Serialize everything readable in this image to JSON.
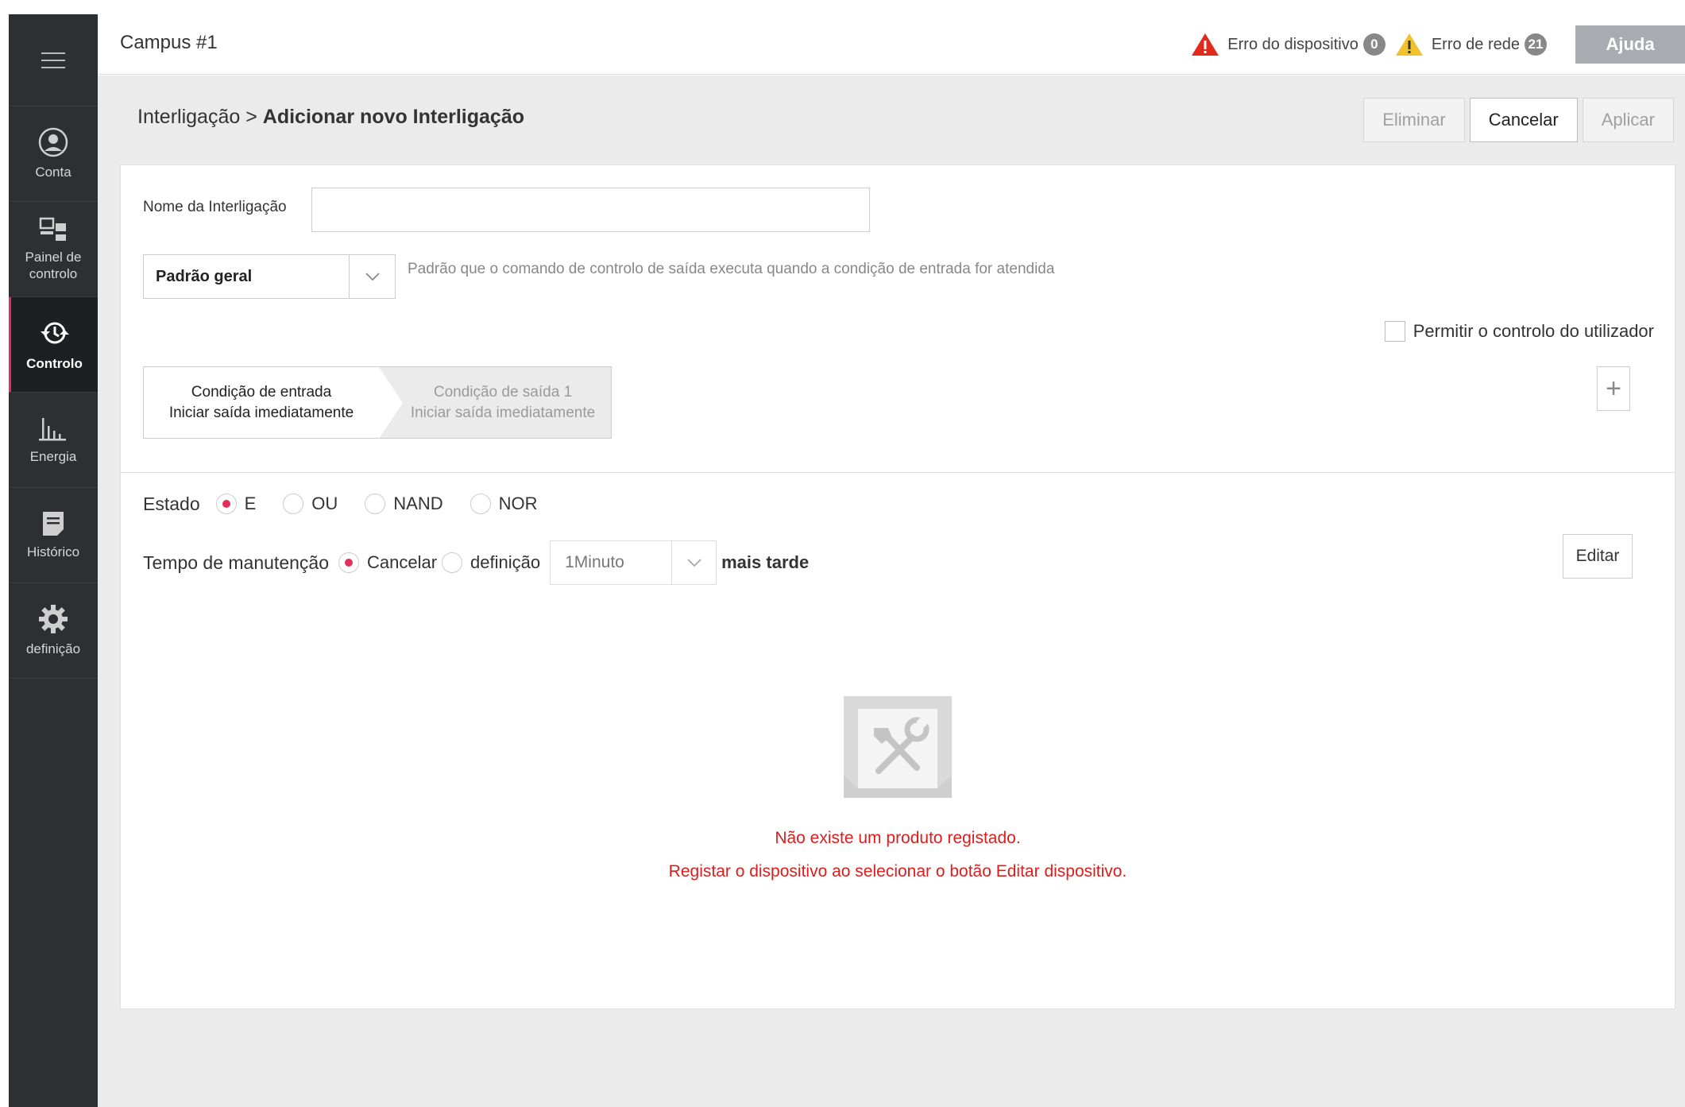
{
  "header": {
    "campus": "Campus #1",
    "device_error_label": "Erro do dispositivo",
    "device_error_count": "0",
    "network_error_label": "Erro de rede",
    "network_error_count": "21",
    "help_label": "Ajuda"
  },
  "sidebar": {
    "items": [
      {
        "label": "Conta",
        "icon": "user-circle-icon"
      },
      {
        "label": "Painel de controlo",
        "icon": "dashboard-icon"
      },
      {
        "label": "Controlo",
        "icon": "control-icon",
        "active": true
      },
      {
        "label": "Energia",
        "icon": "bar-chart-icon"
      },
      {
        "label": "Histórico",
        "icon": "document-icon"
      },
      {
        "label": "definição",
        "icon": "gear-icon"
      }
    ]
  },
  "breadcrumb": {
    "parent": "Interligação",
    "separator": ">",
    "current": "Adicionar novo Interligação"
  },
  "actions": {
    "delete": "Eliminar",
    "cancel": "Cancelar",
    "apply": "Aplicar"
  },
  "form": {
    "name_label": "Nome da Interligação",
    "name_value": "",
    "pattern_value": "Padrão geral",
    "pattern_desc": "Padrão que o comando de controlo de saída executa quando a condição de entrada for atendida",
    "allow_user_label": "Permitir o controlo do utilizador",
    "allow_user_checked": false,
    "input_condition_title": "Condição de entrada",
    "input_condition_sub": "Iniciar saída imediatamente",
    "output_condition_title": "Condição de saída 1",
    "output_condition_sub": "Iniciar saída imediatamente",
    "add_symbol": "+",
    "estado_label": "Estado",
    "estado_options": [
      "E",
      "OU",
      "NAND",
      "NOR"
    ],
    "estado_selected": "E",
    "tempo_label": "Tempo de manutenção",
    "tempo_cancel": "Cancelar",
    "tempo_def": "definição",
    "tempo_selected": "Cancelar",
    "tempo_value": "1Minuto",
    "tempo_suffix": "mais tarde",
    "edit_label": "Editar"
  },
  "empty": {
    "line1": "Não existe um produto registado.",
    "line2": "Registar o dispositivo ao selecionar o botão Editar dispositivo."
  },
  "colors": {
    "accent": "#e0305a",
    "error_text": "#dd1c1c",
    "sidebar_bg": "#2e2f33"
  }
}
